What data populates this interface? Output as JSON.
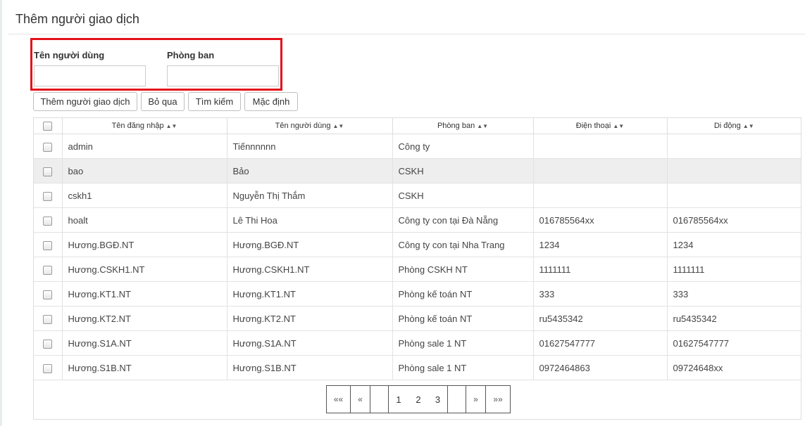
{
  "header": {
    "title": "Thêm người giao dịch"
  },
  "filters": {
    "username_label": "Tên người dùng",
    "username_value": "",
    "department_label": "Phòng ban",
    "department_value": "",
    "highlight_color": "#e3121b"
  },
  "toolbar": {
    "add_label": "Thêm người giao dịch",
    "skip_label": "Bỏ qua",
    "search_label": "Tìm kiếm",
    "default_label": "Mặc định"
  },
  "table": {
    "columns": [
      "Tên đăng nhập",
      "Tên người dùng",
      "Phòng ban",
      "Điện thoại",
      "Di động"
    ],
    "rows": [
      {
        "login": "admin",
        "name": "Tiếnnnnnn",
        "department": "Công ty",
        "phone": "",
        "mobile": "",
        "selected": false
      },
      {
        "login": "bao",
        "name": "Bảo",
        "department": "CSKH",
        "phone": "",
        "mobile": "",
        "selected": true
      },
      {
        "login": "cskh1",
        "name": "Nguyễn Thị Thắm",
        "department": "CSKH",
        "phone": "",
        "mobile": "",
        "selected": false
      },
      {
        "login": "hoalt",
        "name": "Lê Thi Hoa",
        "department": "Công ty con tại Đà Nẵng",
        "phone": "016785564xx",
        "mobile": "016785564xx",
        "selected": false
      },
      {
        "login": "Hương.BGĐ.NT",
        "name": "Hương.BGĐ.NT",
        "department": "Công ty con tại Nha Trang",
        "phone": "1234",
        "mobile": "1234",
        "selected": false
      },
      {
        "login": "Hương.CSKH1.NT",
        "name": "Hương.CSKH1.NT",
        "department": "Phòng CSKH NT",
        "phone": "1111111",
        "mobile": "1111111",
        "selected": false
      },
      {
        "login": "Hương.KT1.NT",
        "name": "Hương.KT1.NT",
        "department": "Phòng kế toán NT",
        "phone": "333",
        "mobile": "333",
        "selected": false
      },
      {
        "login": "Hương.KT2.NT",
        "name": "Hương.KT2.NT",
        "department": "Phòng kế toán NT",
        "phone": "ru5435342",
        "mobile": "ru5435342",
        "selected": false
      },
      {
        "login": "Hương.S1A.NT",
        "name": "Hương.S1A.NT",
        "department": "Phòng sale 1 NT",
        "phone": "01627547777",
        "mobile": "01627547777",
        "selected": false
      },
      {
        "login": "Hương.S1B.NT",
        "name": "Hương.S1B.NT",
        "department": "Phòng sale 1 NT",
        "phone": "0972464863",
        "mobile": "09724648xx",
        "selected": false
      }
    ]
  },
  "pagination": {
    "first": "««",
    "prev": "«",
    "pages": [
      "1",
      "2",
      "3"
    ],
    "next": "»",
    "last": "»»"
  }
}
